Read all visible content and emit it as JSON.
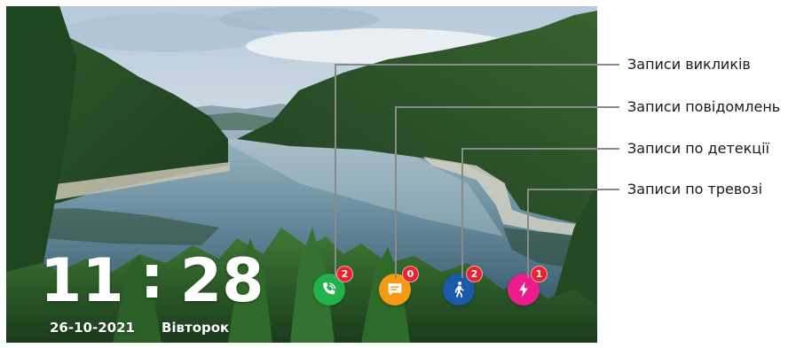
{
  "clock": {
    "hours": "11",
    "separator": ":",
    "minutes": "28"
  },
  "date": {
    "value": "26-10-2021",
    "weekday": "Вівторок"
  },
  "records": [
    {
      "key": "calls",
      "label": "Записи викликів",
      "count": "2",
      "icon": "phone-call-icon",
      "color": "#22b24c"
    },
    {
      "key": "messages",
      "label": "Записи повідомлень",
      "count": "0",
      "icon": "message-icon",
      "color": "#f59a14"
    },
    {
      "key": "detection",
      "label": "Записи по детекції",
      "count": "2",
      "icon": "walking-person-icon",
      "color": "#1a5aa8"
    },
    {
      "key": "alarm",
      "label": "Записи по тревозі",
      "count": "1",
      "icon": "lightning-icon",
      "color": "#ec1c8c"
    }
  ],
  "colors": {
    "badge": "#e8222e",
    "leader_line": "#8a8a8a"
  }
}
